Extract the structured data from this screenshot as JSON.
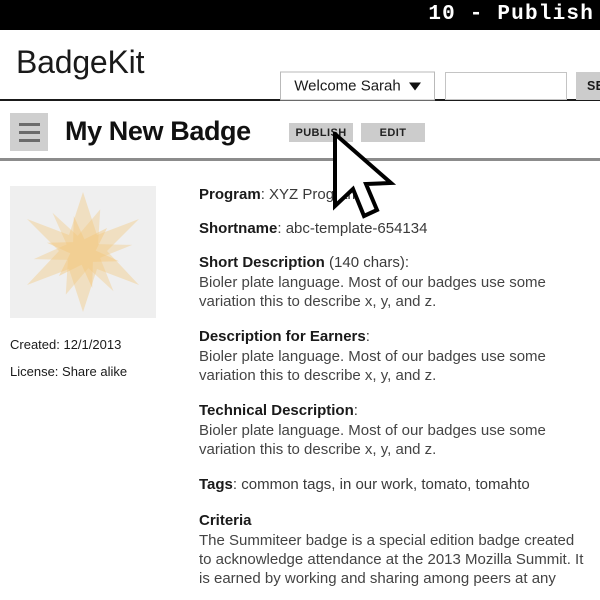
{
  "window": {
    "title": "10 - Publish"
  },
  "header": {
    "brand": "BadgeKit",
    "user_menu_label": "Welcome Sarah",
    "caret_icon": "chevron-down-icon",
    "search_value": "",
    "search_placeholder": "",
    "search_button_label": "SEARCH"
  },
  "title_bar": {
    "menu_icon": "hamburger-menu-icon",
    "page_title": "My New Badge",
    "publish_label": "PUBLISH",
    "edit_label": "EDIT"
  },
  "badge": {
    "image_alt": "star-badge-image",
    "created_label": "Created: 12/1/2013",
    "license_label": "License: Share alike",
    "star_color": "#f7cb7f",
    "frame_color": "#efefef"
  },
  "details": {
    "program": {
      "label": "Program",
      "separator": ": ",
      "value": "XYZ Program"
    },
    "shortname": {
      "label": "Shortname",
      "separator": ": ",
      "value": "abc-template-654134"
    },
    "short_description": {
      "label": "Short Description",
      "extra": " (140 chars):",
      "body": "Bioler plate language. Most of our badges use some\nvariation this to describe x, y, and z."
    },
    "description_for_earners": {
      "label": "Description for Earners",
      "extra": ":",
      "body": "Bioler plate language. Most of our badges use some\nvariation this to describe x, y, and z."
    },
    "technical_description": {
      "label": "Technical Description",
      "extra": ":",
      "body": "Bioler plate language. Most of our badges use some\nvariation this to describe x, y, and z."
    },
    "tags": {
      "label": "Tags",
      "separator": ": ",
      "value": "common tags, in our work, tomato, tomahto"
    },
    "criteria": {
      "label": "Criteria",
      "body": "The Summiteer badge is a special edition badge created\nto acknowledge attendance at the 2013 Mozilla Summit. It\nis earned by working and sharing among peers at any"
    }
  },
  "cursor": {
    "icon": "mouse-pointer-arrow-icon"
  }
}
